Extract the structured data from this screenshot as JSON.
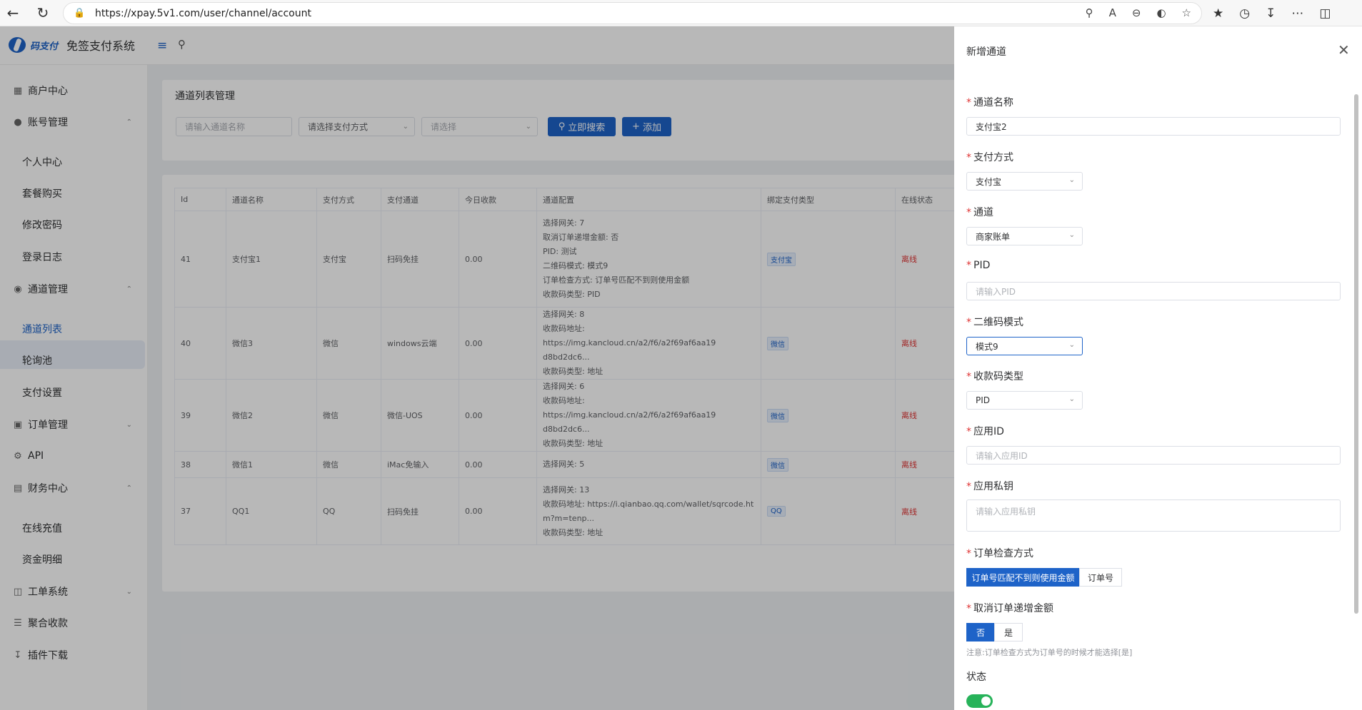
{
  "browser": {
    "url": "https://xpay.5v1.com/user/channel/account"
  },
  "app": {
    "logo_script": "码支付",
    "title": "免签支付系统"
  },
  "sidebar": {
    "items": [
      {
        "label": "商户中心"
      },
      {
        "label": "账号管理"
      },
      {
        "label": "个人中心"
      },
      {
        "label": "套餐购买"
      },
      {
        "label": "修改密码"
      },
      {
        "label": "登录日志"
      },
      {
        "label": "通道管理"
      },
      {
        "label": "通道列表"
      },
      {
        "label": "轮询池"
      },
      {
        "label": "支付设置"
      },
      {
        "label": "订单管理"
      },
      {
        "label": "API"
      },
      {
        "label": "财务中心"
      },
      {
        "label": "在线充值"
      },
      {
        "label": "资金明细"
      },
      {
        "label": "工单系统"
      },
      {
        "label": "聚合收款"
      },
      {
        "label": "插件下载"
      }
    ]
  },
  "search_card": {
    "title": "通道列表管理",
    "name_placeholder": "请输入通道名称",
    "pay_method_placeholder": "请选择支付方式",
    "select_placeholder": "请选择",
    "search_button": "立即搜索",
    "add_button": "添加"
  },
  "table": {
    "headers": [
      "Id",
      "通道名称",
      "支付方式",
      "支付通道",
      "今日收款",
      "通道配置",
      "绑定支付类型",
      "在线状态"
    ],
    "rows": [
      {
        "id": "41",
        "name": "支付宝1",
        "method": "支付宝",
        "channel": "扫码免挂",
        "today": "0.00",
        "config": [
          "选择网关: 7",
          "取消订单递增金额: 否",
          "PID: 测试",
          "二维码模式: 模式9",
          "订单检查方式: 订单号匹配不到则使用金额",
          "收款码类型: PID"
        ],
        "bind": "支付宝",
        "status": "离线"
      },
      {
        "id": "40",
        "name": "微信3",
        "method": "微信",
        "channel": "windows云端",
        "today": "0.00",
        "config": [
          "选择网关: 8",
          "收款码地址: https://img.kancloud.cn/a2/f6/a2f69af6aa19",
          "d8bd2dc6...",
          "收款码类型: 地址"
        ],
        "bind": "微信",
        "status": "离线"
      },
      {
        "id": "39",
        "name": "微信2",
        "method": "微信",
        "channel": "微信-UOS",
        "today": "0.00",
        "config": [
          "选择网关: 6",
          "收款码地址: https://img.kancloud.cn/a2/f6/a2f69af6aa19",
          "d8bd2dc6...",
          "收款码类型: 地址"
        ],
        "bind": "微信",
        "status": "离线"
      },
      {
        "id": "38",
        "name": "微信1",
        "method": "微信",
        "channel": "iMac免输入",
        "today": "0.00",
        "config": [
          "选择网关: 5"
        ],
        "bind": "微信",
        "status": "离线"
      },
      {
        "id": "37",
        "name": "QQ1",
        "method": "QQ",
        "channel": "扫码免挂",
        "today": "0.00",
        "config": [
          "选择网关: 13",
          "收款码地址: https://i.qianbao.qq.com/wallet/sqrcode.ht",
          "m?m=tenp...",
          "收款码类型: 地址"
        ],
        "bind": "QQ",
        "status": "离线"
      }
    ]
  },
  "drawer": {
    "title": "新增通道",
    "fields": {
      "channel_name": {
        "label": "通道名称",
        "value": "支付宝2"
      },
      "pay_method": {
        "label": "支付方式",
        "value": "支付宝"
      },
      "channel": {
        "label": "通道",
        "value": "商家账单"
      },
      "pid": {
        "label": "PID",
        "placeholder": "请输入PID"
      },
      "qr_mode": {
        "label": "二维码模式",
        "value": "模式9"
      },
      "code_type": {
        "label": "收款码类型",
        "value": "PID"
      },
      "app_id": {
        "label": "应用ID",
        "placeholder": "请输入应用ID"
      },
      "app_key": {
        "label": "应用私钥",
        "placeholder": "请输入应用私钥"
      },
      "check_method": {
        "label": "订单检查方式",
        "options": [
          "订单号匹配不到则使用金额",
          "订单号"
        ],
        "selected": 0
      },
      "cancel_increment": {
        "label": "取消订单递增金额",
        "options": [
          "否",
          "是"
        ],
        "selected": 0
      },
      "hint": "注意:订单检查方式为订单号的时候才能选择[是]",
      "status": {
        "label": "状态",
        "on": true
      }
    }
  },
  "colors": {
    "accent": "#1e63c8",
    "danger": "#e03535",
    "switch_on": "#27b35a"
  }
}
